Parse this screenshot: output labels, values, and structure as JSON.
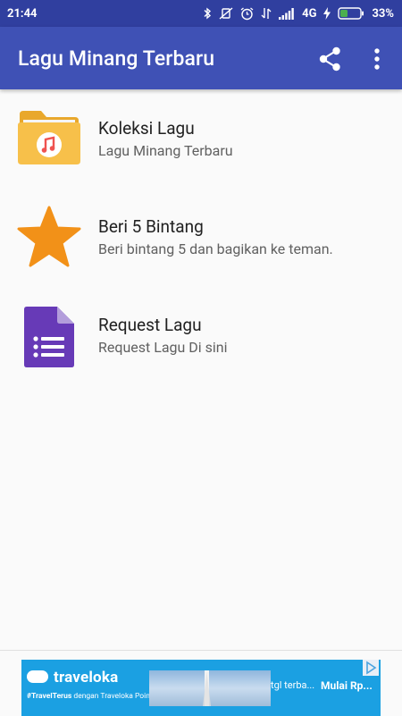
{
  "status_bar": {
    "time": "21:44",
    "network": "4G",
    "battery": "33%",
    "icons": [
      "bluetooth-icon",
      "vibrate-icon",
      "alarm-icon",
      "data-icon",
      "signal-icon",
      "charging-icon",
      "battery-icon"
    ]
  },
  "app_bar": {
    "title": "Lagu Minang Terbaru",
    "actions": [
      "share-icon",
      "more-vert-icon"
    ]
  },
  "menu": {
    "items": [
      {
        "title": "Koleksi Lagu",
        "subtitle": "Lagu Minang Terbaru",
        "icon": "music-folder-icon"
      },
      {
        "title": "Beri 5 Bintang",
        "subtitle": "Beri bintang 5 dan bagikan ke teman.",
        "icon": "star-icon"
      },
      {
        "title": "Request Lagu",
        "subtitle": "Request Lagu Di sini",
        "icon": "form-icon"
      }
    ]
  },
  "ad": {
    "brand": "traveloka",
    "tagline_bold": "#TravelTerus",
    "tagline_rest": " dengan Traveloka Poin",
    "middle_text": "tgl terba...",
    "cta": "Mulai Rp..."
  },
  "colors": {
    "status_bar": "#303f9f",
    "app_bar": "#3f51b5",
    "folder": "#f7c04a",
    "star": "#f29118",
    "form": "#673ab7",
    "ad_bg": "#1ba0e2"
  }
}
